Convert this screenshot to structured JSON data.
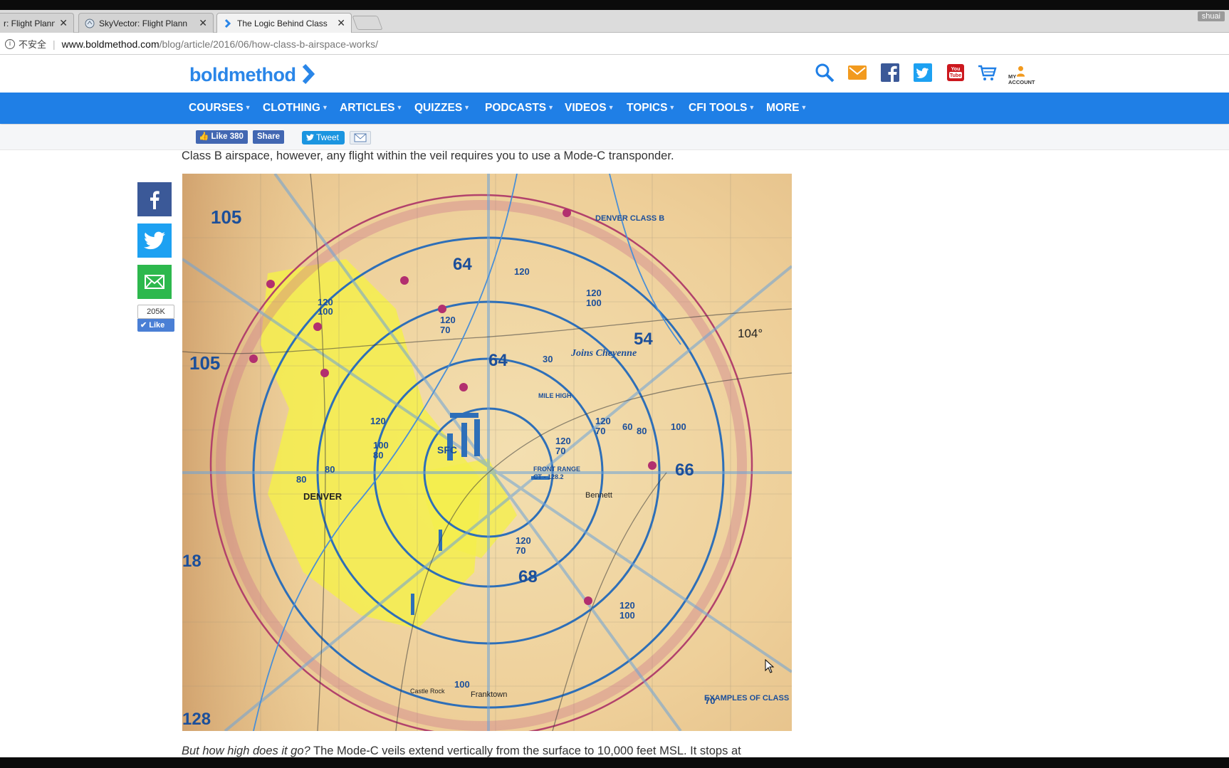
{
  "browser": {
    "tabs": [
      {
        "title": "r: Flight Plann",
        "active": false
      },
      {
        "title": "SkyVector: Flight Plann",
        "active": false
      },
      {
        "title": "The Logic Behind Class",
        "active": true
      }
    ],
    "profile_name": "shuai",
    "address": {
      "security_label": "不安全",
      "domain": "www.boldmethod.com",
      "path": "/blog/article/2016/06/how-class-b-airspace-works/"
    }
  },
  "site": {
    "logo_text": "boldmethod",
    "account_label_1": "MY",
    "account_label_2": "ACCOUNT",
    "nav": [
      {
        "label": "COURSES"
      },
      {
        "label": "CLOTHING"
      },
      {
        "label": "ARTICLES"
      },
      {
        "label": "QUIZZES"
      },
      {
        "label": "PODCASTS"
      },
      {
        "label": "VIDEOS"
      },
      {
        "label": "TOPICS"
      },
      {
        "label": "CFI TOOLS"
      },
      {
        "label": "MORE"
      }
    ],
    "share": {
      "like_label": "Like 380",
      "share_label": "Share",
      "tweet_label": "Tweet"
    }
  },
  "article": {
    "intro_text": "Class B airspace, however, any flight within the veil requires you to use a Mode-C transponder.",
    "after_italic": "But how high does it go?",
    "after_text": " The Mode-C veils extend vertically from the surface to 10,000 feet MSL. It stops at",
    "side_like_count": "205K",
    "side_like_label": "Like"
  },
  "map": {
    "labels": {
      "big_numbers": [
        "105",
        "105",
        "64",
        "64",
        "54",
        "66",
        "68",
        "18",
        "128"
      ],
      "freqs": [
        "120",
        "100",
        "80",
        "120",
        "70",
        "120",
        "100",
        "120",
        "80",
        "120",
        "70",
        "100",
        "120",
        "70",
        "60",
        "120",
        "70",
        "80",
        "100",
        "120",
        "100",
        "80",
        "120",
        "100",
        "70",
        "30"
      ],
      "place_denver": "DENVER",
      "class_b": "DENVER CLASS B",
      "cheyenne": "Joins Cheyenne",
      "deg": "104°",
      "examples": "EXAMPLES OF CLASS B",
      "frankt": "Franktown",
      "mile_high": "MILE HIGH",
      "front_range": "FRONT RANGE",
      "ct_freq": "CT - 128.2",
      "bennett": "Bennett",
      "sfc": "SFC",
      "castle": "Castle Rock"
    }
  }
}
